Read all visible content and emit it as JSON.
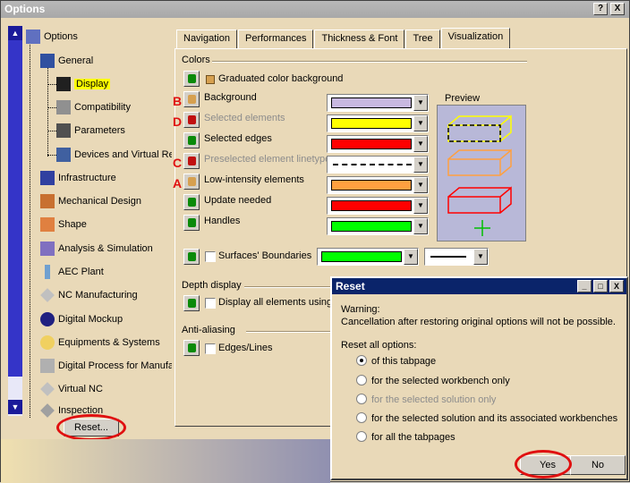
{
  "window": {
    "title": "Options",
    "help_btn": "?",
    "close_btn": "X"
  },
  "tree": {
    "root": "Options",
    "general": "General",
    "children": [
      "Display",
      "Compatibility",
      "Parameters",
      "Devices and Virtual Re"
    ],
    "items": [
      "Infrastructure",
      "Mechanical Design",
      "Shape",
      "Analysis & Simulation",
      "AEC Plant",
      "NC Manufacturing",
      "Digital Mockup",
      "Equipments & Systems",
      "Digital Process for Manufa",
      "Virtual NC",
      "Inspection"
    ],
    "reset_label": "Reset..."
  },
  "tabs": [
    "Navigation",
    "Performances",
    "Thickness & Font",
    "Tree",
    "Visualization"
  ],
  "colors": {
    "group_label": "Colors",
    "graduated_label": "Graduated color background",
    "preview_label": "Preview",
    "rows": [
      {
        "letter": "B",
        "label": "Background",
        "swatch": "#c8b8e0"
      },
      {
        "letter": "D",
        "label": "Selected elements",
        "swatch": "#ffff00"
      },
      {
        "letter": "",
        "label": "Selected edges",
        "swatch": "#ff0000"
      },
      {
        "letter": "C",
        "label": "Preselected element linetype",
        "swatch": ""
      },
      {
        "letter": "A",
        "label": "Low-intensity elements",
        "swatch": "#ffa040"
      },
      {
        "letter": "",
        "label": "Update needed",
        "swatch": "#ff0000"
      },
      {
        "letter": "",
        "label": "Handles",
        "swatch": "#00ff00"
      }
    ],
    "surfaces_label": "Surfaces' Boundaries",
    "surfaces_swatch": "#00ff00"
  },
  "depth": {
    "group_label": "Depth display",
    "option_label": "Display all elements using Z"
  },
  "antialias": {
    "group_label": "Anti-aliasing",
    "option_label": "Edges/Lines"
  },
  "reset_dialog": {
    "title": "Reset",
    "warning_title": "Warning:",
    "warning_text": "Cancellation after restoring original options will not be possible.",
    "reset_all": "Reset all options:",
    "options": [
      "of this tabpage",
      "for the selected workbench only",
      "for the selected solution only",
      "for the selected solution and its associated workbenches",
      "for all the tabpages"
    ],
    "yes": "Yes",
    "no": "No",
    "min_btn": "_",
    "max_btn": "□",
    "close_btn": "X"
  }
}
